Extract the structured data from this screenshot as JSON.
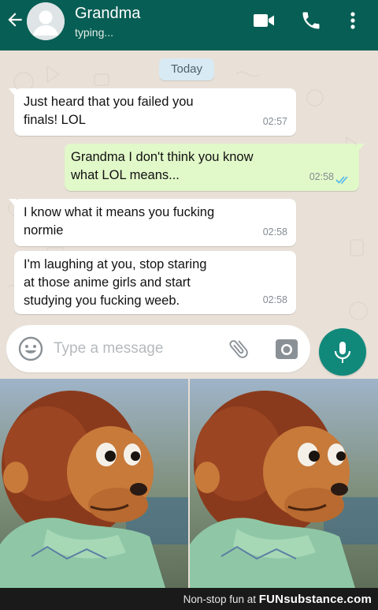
{
  "header": {
    "contact_name": "Grandma",
    "status": "typing...",
    "icons": [
      "back-arrow-icon",
      "avatar-icon",
      "video-call-icon",
      "voice-call-icon",
      "more-options-icon"
    ],
    "background_color": "#075e54"
  },
  "chat": {
    "date_label": "Today",
    "messages": [
      {
        "direction": "incoming",
        "line1": "Just heard that you failed you",
        "line2": "finals! LOL",
        "line3": "",
        "time": "02:57"
      },
      {
        "direction": "outgoing",
        "line1": "Grandma I don't think you know",
        "line2": "what LOL means...",
        "line3": "",
        "time": "02:58",
        "read": true
      },
      {
        "direction": "incoming",
        "line1": "I know what it means you fucking",
        "line2": "normie",
        "line3": "",
        "time": "02:58"
      },
      {
        "direction": "incoming",
        "line1": "I'm laughing at you, stop staring",
        "line2": "at those anime girls and start",
        "line3": "studying you fucking weeb.",
        "time": "02:58"
      }
    ]
  },
  "composer": {
    "placeholder": "Type a message",
    "icons": [
      "emoji-icon",
      "attach-icon",
      "camera-icon",
      "mic-icon"
    ],
    "accent_color": "#10897b"
  },
  "meme": {
    "panels": [
      "monkey-puppet-looking-away",
      "monkey-puppet-looking-away-side-eye"
    ]
  },
  "footer": {
    "caption": "Non-stop fun at",
    "brand_bold": "FUN",
    "brand_rest": "substance.com"
  }
}
